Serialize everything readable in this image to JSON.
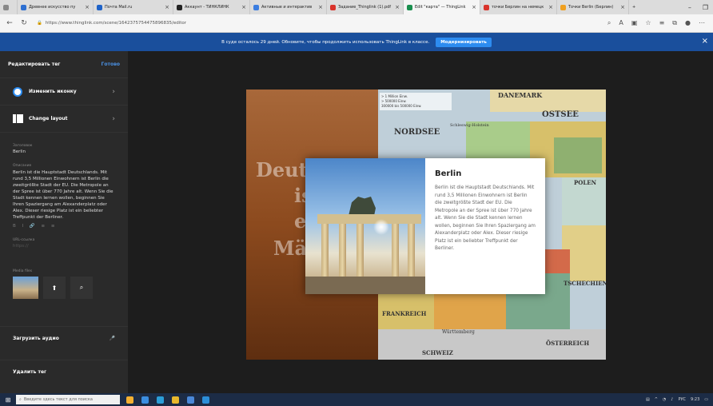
{
  "browser": {
    "tabs": [
      {
        "label": "Древнее искусство пу",
        "color": "#2d6fd1"
      },
      {
        "label": "Почта Mail.ru",
        "color": "#1f63c8"
      },
      {
        "label": "Аккаунт - ТИНКЛИНК",
        "color": "#222222"
      },
      {
        "label": "Активные и интерактив",
        "color": "#3b7de0"
      },
      {
        "label": "Задание_Thinglink (1).pdf",
        "color": "#d9332b"
      },
      {
        "label": "Edit \"карта\" — ThingLink",
        "color": "#1a8f4f",
        "active": true
      },
      {
        "label": "точки Берлин на немецк",
        "color": "#d9332b"
      },
      {
        "label": "Точки Berlin (Берлин)",
        "color": "#f0a020"
      }
    ],
    "url": "https://www.thinglink.com/scene/1642375754475896835/editor"
  },
  "banner": {
    "text": "В суде осталось 29 дней. Обновите, чтобы продолжить использовать ThingLink в классе.",
    "upgrade_label": "Модернизировать"
  },
  "panel": {
    "title": "Редактировать тег",
    "done": "Готово",
    "change_icon": "Изменить иконку",
    "change_layout": "Change layout",
    "title_label": "Заголовок",
    "title_value": "Berlin",
    "desc_label": "Описание",
    "description": "Berlin ist die Hauptstadt Deutschlands. Mit rund 3,5 Millionen Einwohnern ist Berlin die zweitgrößte Stadt der EU. Die Metropole an der Spree ist über 770 Jahre alt. Wenn Sie die Stadt kennen lernen wollen, beginnen Sie Ihren Spaziergang am Alexanderplatz oder Alex. Dieser riesige Platz ist ein beliebter Treffpunkt der Berliner.",
    "format_icons": "B I 🔗 ≡ ≡",
    "url_label": "URL-ссылка",
    "url_placeholder": "https://",
    "media_label": "Media files",
    "upload_audio": "Загрузить аудио",
    "delete_tag": "Удалить тег"
  },
  "map": {
    "title_words": [
      "Deutschland",
      "ist",
      "ein",
      "Märchen"
    ],
    "labels": {
      "dansemark": "DANEMARK",
      "ostsee": "OSTSEE",
      "nordsee": "NORDSEE",
      "schleswig": "Schleswig-Holstein",
      "polen": "POLEN",
      "tschechien": "TSCHECHIEN",
      "frankreich": "FRANKREICH",
      "schweiz": "SCHWEIZ",
      "oesterreich": "ÖSTERREICH",
      "wuerttemberg": "Württemberg",
      "legend1": "> 1 Million Einw.",
      "legend2": "> 500000 Einw.",
      "legend3": "300000 bis 500000 Einw."
    }
  },
  "popup": {
    "title": "Berlin",
    "body": "Berlin ist die Hauptstadt Deutschlands. Mit rund 3,5 Millionen Einwohnern ist Berlin die zweitgrößte Stadt der EU. Die Metropole an der Spree ist über 770 Jahre alt. Wenn Sie die Stadt kennen lernen wollen, beginnen Sie Ihren Spaziergang am Alexanderplatz oder Alex. Dieser riesige Platz ist ein beliebter Treffpunkt der Berliner."
  },
  "taskbar": {
    "search_placeholder": "Введите здесь текст для поиска",
    "lang": "РУС",
    "time": "9:23"
  }
}
